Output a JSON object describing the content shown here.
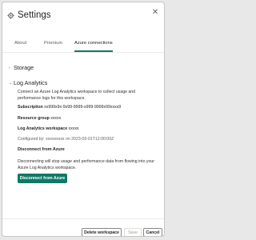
{
  "window": {
    "title": "Settings",
    "close_glyph": "✕"
  },
  "tabs": [
    {
      "label": "About"
    },
    {
      "label": "Premium"
    },
    {
      "label": "Azure connections",
      "active": true
    }
  ],
  "sections": {
    "storage": {
      "label": "Storage",
      "expanded": false,
      "chevron": "›"
    },
    "log_analytics": {
      "label": "Log Analytics",
      "expanded": true,
      "chevron": "⌄"
    }
  },
  "log_analytics": {
    "description": "Connect an Azure Log Analytics workspace to collect usage and performance logs for this workspace.",
    "subscription_label": "Subscription",
    "subscription_value": "xx999x9x-9x99-9999-x999-9999x99xxxx9",
    "resource_group_label": "Resource group",
    "resource_group_value": "xxxxx",
    "workspace_label": "Log Analytics workspace",
    "workspace_value": "xxxxx",
    "configured_text": "Configured by: xxxxxxxxx on 2023-03-01T12:00:00Z",
    "disconnect_heading": "Disconnect from Azure",
    "disconnect_description": "Disconnecting will stop usage and performance data from flowing into your Azure Log Analytics workspace.",
    "disconnect_button": "Disconnect from Azure"
  },
  "footer": {
    "delete_label": "Delete workspace",
    "save_label": "Save",
    "cancel_label": "Cancel"
  },
  "colors": {
    "accent": "#117865",
    "text": "#252423",
    "muted": "#605e5c"
  },
  "icons": {
    "header": "gear-icon",
    "close": "close-icon"
  }
}
